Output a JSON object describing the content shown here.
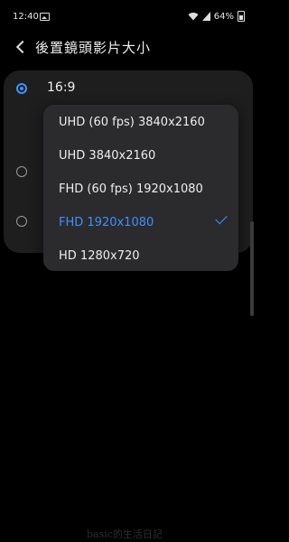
{
  "status_bar": {
    "time": "12:40",
    "battery": "64%",
    "icons": [
      "gallery-notification-icon",
      "wifi-icon",
      "signal-icon",
      "battery-icon"
    ]
  },
  "header": {
    "title": "後置鏡頭影片大小",
    "back_icon": "back-arrow-icon"
  },
  "options": [
    {
      "label": "16:9",
      "selected": true
    },
    {
      "label": "",
      "selected": false
    },
    {
      "label": "",
      "selected": false
    }
  ],
  "dropdown": {
    "items": [
      {
        "label": "UHD (60 fps) 3840x2160",
        "selected": false
      },
      {
        "label": "UHD 3840x2160",
        "selected": false
      },
      {
        "label": "FHD (60 fps) 1920x1080",
        "selected": false
      },
      {
        "label": "FHD 1920x1080",
        "selected": true
      },
      {
        "label": "HD 1280x720",
        "selected": false
      }
    ]
  },
  "watermark": "basic的生活日記",
  "colors": {
    "accent": "#3e91ff",
    "background": "#000000",
    "card": "#1e1e1e",
    "menu": "#2b2b2e",
    "text": "#eeeeee"
  }
}
